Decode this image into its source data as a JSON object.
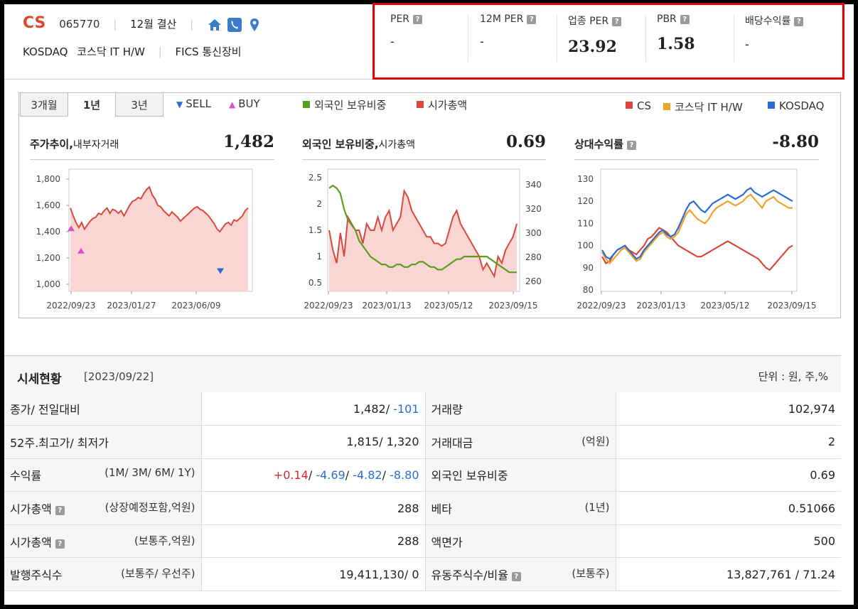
{
  "header": {
    "ticker": "CS",
    "code": "065770",
    "settlement": "12월 결산",
    "market": "KOSDAQ",
    "sector": "코스닥 IT H/W",
    "fics": "FICS 통신장비",
    "icons": [
      "home-icon",
      "phone-icon",
      "location-icon"
    ]
  },
  "metrics": [
    {
      "label": "PER",
      "value": "-"
    },
    {
      "label": "12M PER",
      "value": "-"
    },
    {
      "label": "업종 PER",
      "value": "23.92"
    },
    {
      "label": "PBR",
      "value": "1.58"
    },
    {
      "label": "배당수익률",
      "value": "-"
    }
  ],
  "tabs": [
    "3개월",
    "1년",
    "3년"
  ],
  "active_tab": "1년",
  "legend": {
    "sell": "SELL",
    "buy": "BUY",
    "foreign": "외국인 보유비중",
    "marketcap": "시가총액",
    "cs": "CS",
    "sector": "코스닥 IT H/W",
    "kosdaq": "KOSDAQ"
  },
  "colors": {
    "cs": "#d9483b",
    "foreign": "#5a9e1b",
    "sector": "#f2a12a",
    "kosdaq": "#2a6bd4",
    "sell": "#2a6bd4",
    "buy": "#d94fc8",
    "accent": "#e2462b"
  },
  "panels": {
    "price": {
      "title": "주가추이,",
      "subtitle": "내부자거래",
      "value": "1,482"
    },
    "foreign": {
      "title": "외국인 보유비중,",
      "subtitle": "시가총액",
      "value": "0.69"
    },
    "relative": {
      "title": "상대수익률",
      "value": "-8.80"
    }
  },
  "chart_data": [
    {
      "type": "area",
      "name": "price",
      "ylim": [
        1000,
        1800
      ],
      "yticks": [
        "1,800",
        "1,600",
        "1,400",
        "1,200",
        "1,000"
      ],
      "xticks": [
        "2022/09/23",
        "2023/01/27",
        "2023/06/09"
      ],
      "series": [
        {
          "values": [
            1580,
            1520,
            1470,
            1430,
            1470,
            1420,
            1450,
            1480,
            1500,
            1510,
            1540,
            1530,
            1560,
            1580,
            1540,
            1570,
            1560,
            1540,
            1560,
            1520,
            1560,
            1600,
            1630,
            1640,
            1660,
            1650,
            1690,
            1720,
            1740,
            1680,
            1650,
            1600,
            1590,
            1560,
            1540,
            1520,
            1550,
            1530,
            1510,
            1480,
            1500,
            1520,
            1540,
            1560,
            1580,
            1590,
            1570,
            1560,
            1540,
            1520,
            1490,
            1460,
            1420,
            1400,
            1430,
            1460,
            1470,
            1450,
            1490,
            1480,
            1500,
            1520,
            1560,
            1580
          ]
        }
      ],
      "sell_markers": [
        1100
      ],
      "buy_markers": [
        1420,
        1250
      ]
    },
    {
      "type": "line",
      "name": "foreign-marketcap",
      "ylim_left": [
        0.5,
        2.5
      ],
      "yticks_left": [
        "2.5",
        "2",
        "1.5",
        "1",
        "0.5"
      ],
      "ylim_right": [
        260,
        340
      ],
      "yticks_right": [
        "340",
        "320",
        "300",
        "280",
        "260"
      ],
      "xticks": [
        "2022/09/23",
        "2023/01/13",
        "2023/05/12",
        "2023/09/15"
      ],
      "series": [
        {
          "name": "외국인 보유비중",
          "values": [
            2.3,
            2.35,
            2.3,
            2.2,
            1.9,
            1.7,
            1.6,
            1.5,
            1.3,
            1.2,
            1.1,
            1.0,
            0.95,
            0.9,
            0.85,
            0.85,
            0.8,
            0.8,
            0.85,
            0.85,
            0.8,
            0.8,
            0.85,
            0.85,
            0.9,
            0.9,
            0.85,
            0.8,
            0.8,
            0.75,
            0.75,
            0.8,
            0.85,
            0.9,
            0.95,
            0.95,
            1.0,
            1.0,
            1.0,
            1.0,
            1.0,
            1.0,
            1.0,
            0.95,
            0.9,
            0.85,
            0.8,
            0.75,
            0.7,
            0.7,
            0.7
          ]
        },
        {
          "name": "시가총액",
          "values": [
            300,
            285,
            275,
            298,
            280,
            310,
            305,
            300,
            300,
            290,
            305,
            300,
            300,
            310,
            300,
            310,
            315,
            300,
            305,
            310,
            330,
            325,
            315,
            310,
            305,
            300,
            295,
            295,
            290,
            290,
            288,
            290,
            300,
            310,
            315,
            305,
            300,
            295,
            290,
            285,
            280,
            270,
            275,
            270,
            265,
            280,
            275,
            285,
            290,
            295,
            305
          ]
        }
      ]
    },
    {
      "type": "line",
      "name": "relative-return",
      "ylim": [
        80,
        130
      ],
      "yticks": [
        "130",
        "120",
        "110",
        "100",
        "90",
        "80"
      ],
      "xticks": [
        "2022/09/23",
        "2023/01/13",
        "2023/05/12",
        "2023/09/15"
      ],
      "series": [
        {
          "name": "CS",
          "values": [
            95,
            92,
            93,
            96,
            98,
            99,
            100,
            98,
            97,
            96,
            98,
            100,
            103,
            104,
            106,
            108,
            107,
            106,
            104,
            102,
            100,
            99,
            98,
            97,
            96,
            95,
            95,
            96,
            97,
            98,
            99,
            100,
            101,
            102,
            101,
            100,
            99,
            98,
            97,
            96,
            95,
            94,
            92,
            90,
            89,
            91,
            93,
            95,
            97,
            99,
            100
          ]
        },
        {
          "name": "코스닥 IT H/W",
          "values": [
            97,
            94,
            92,
            94,
            96,
            98,
            99,
            97,
            95,
            93,
            94,
            97,
            99,
            101,
            103,
            105,
            106,
            104,
            103,
            104,
            106,
            110,
            114,
            116,
            114,
            112,
            111,
            110,
            112,
            115,
            117,
            118,
            119,
            120,
            119,
            118,
            119,
            120,
            122,
            123,
            121,
            119,
            117,
            120,
            121,
            122,
            120,
            119,
            118,
            117,
            117
          ]
        },
        {
          "name": "KOSDAQ",
          "values": [
            98,
            95,
            94,
            96,
            98,
            99,
            100,
            98,
            96,
            94,
            95,
            98,
            100,
            102,
            104,
            106,
            107,
            105,
            104,
            105,
            108,
            112,
            116,
            119,
            120,
            118,
            116,
            115,
            117,
            119,
            120,
            121,
            122,
            123,
            122,
            121,
            122,
            123,
            125,
            126,
            124,
            123,
            122,
            123,
            124,
            125,
            124,
            123,
            122,
            121,
            120
          ]
        }
      ]
    }
  ],
  "status": {
    "title": "시세현황",
    "date": "[2023/09/22]",
    "unit": "단위 : 원, 주,%",
    "rows": [
      {
        "label": "종가/ 전일대비",
        "sub": "",
        "value_parts": [
          {
            "t": "1,482/ ",
            "c": ""
          },
          {
            "t": "-101",
            "c": "dn"
          }
        ],
        "label2": "거래량",
        "sub2": "",
        "value2": "102,974"
      },
      {
        "label": "52주.최고가/ 최저가",
        "sub": "",
        "value_parts": [
          {
            "t": "1,815/ 1,320",
            "c": ""
          }
        ],
        "label2": "거래대금",
        "sub2": "(억원)",
        "value2": "2"
      },
      {
        "label": "수익률",
        "sub": "(1M/ 3M/ 6M/ 1Y)",
        "value_parts": [
          {
            "t": "+0.14",
            "c": "up"
          },
          {
            "t": "/ ",
            "c": ""
          },
          {
            "t": "-4.69",
            "c": "dn"
          },
          {
            "t": "/ ",
            "c": ""
          },
          {
            "t": "-4.82",
            "c": "dn"
          },
          {
            "t": "/ ",
            "c": ""
          },
          {
            "t": "-8.80",
            "c": "dn"
          }
        ],
        "label2": "외국인 보유비중",
        "sub2": "",
        "value2": "0.69"
      },
      {
        "label": "시가총액",
        "sub": "(상장예정포함,억원)",
        "help": true,
        "value_parts": [
          {
            "t": "288",
            "c": ""
          }
        ],
        "label2": "베타",
        "sub2": "(1년)",
        "value2": "0.51066"
      },
      {
        "label": "시가총액",
        "sub": "(보통주,억원)",
        "help": true,
        "value_parts": [
          {
            "t": "288",
            "c": ""
          }
        ],
        "label2": "액면가",
        "sub2": "",
        "value2": "500"
      },
      {
        "label": "발행주식수",
        "sub": "(보통주/ 우선주)",
        "value_parts": [
          {
            "t": "19,411,130/ 0",
            "c": ""
          }
        ],
        "label2": "유동주식수/비율",
        "sub2": "(보통주)",
        "help2": true,
        "value2": "13,827,761 / 71.24"
      }
    ]
  }
}
